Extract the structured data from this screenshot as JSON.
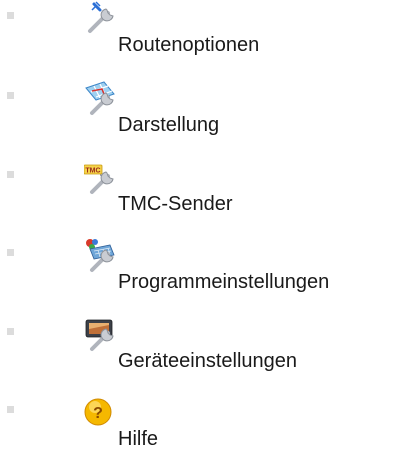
{
  "menu": {
    "items": [
      {
        "label": "Routenoptionen",
        "icon": "route-options-wrench-icon"
      },
      {
        "label": "Darstellung",
        "icon": "map-display-wrench-icon"
      },
      {
        "label": "TMC-Sender",
        "icon": "tmc-antenna-wrench-icon"
      },
      {
        "label": "Programmeinstellungen",
        "icon": "program-keyboard-wrench-icon"
      },
      {
        "label": "Geräteeinstellungen",
        "icon": "device-wrench-icon"
      },
      {
        "label": "Hilfe",
        "icon": "help-question-icon"
      }
    ]
  },
  "colors": {
    "bullet": "#dcdcdc",
    "text": "#1a1a1a",
    "wrench": "#b8bcc4",
    "help": "#f5b800"
  }
}
